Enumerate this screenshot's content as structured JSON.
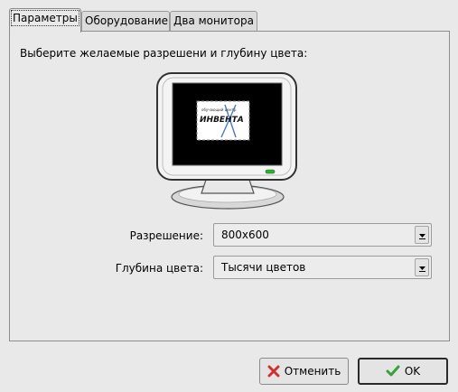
{
  "tabs": [
    {
      "label": "Параметры",
      "active": true
    },
    {
      "label": "Оборудование",
      "active": false
    },
    {
      "label": "Два монитора",
      "active": false
    }
  ],
  "prompt": "Выберите желаемые разрешени и глубину цвета:",
  "monitor": {
    "logo_small_text": "обучающий центр",
    "logo_text": "ИНВЕНТА",
    "led_color": "#2db22d"
  },
  "resolution": {
    "label": "Разрешение:",
    "value": "800x600"
  },
  "color_depth": {
    "label": "Глубина цвета:",
    "value": "Тысячи цветов"
  },
  "buttons": {
    "cancel": {
      "label": "Отменить",
      "icon": "cancel-x-icon",
      "icon_color": "#d03030"
    },
    "ok": {
      "label": "OK",
      "icon": "check-icon",
      "icon_color": "#3aa03a"
    }
  }
}
